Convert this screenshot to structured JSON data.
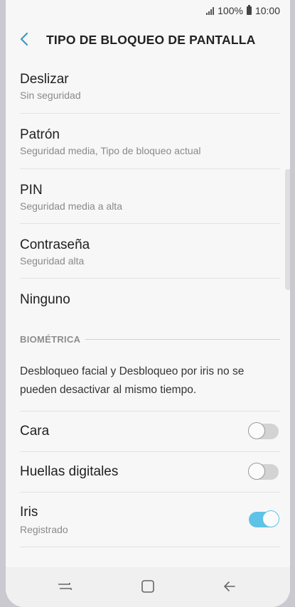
{
  "status_bar": {
    "battery": "100%",
    "time": "10:00"
  },
  "header": {
    "title": "TIPO DE BLOQUEO DE PANTALLA"
  },
  "lock_options": [
    {
      "label": "Deslizar",
      "sub": "Sin seguridad"
    },
    {
      "label": "Patrón",
      "sub": "Seguridad media, Tipo de bloqueo actual"
    },
    {
      "label": "PIN",
      "sub": "Seguridad media a alta"
    },
    {
      "label": "Contraseña",
      "sub": "Seguridad alta"
    },
    {
      "label": "Ninguno"
    }
  ],
  "biometrics": {
    "section_title": "BIOMÉTRICA",
    "info": "Desbloqueo facial y Desbloqueo por iris no se pueden desactivar al mismo tiempo.",
    "items": [
      {
        "label": "Cara",
        "enabled": false
      },
      {
        "label": "Huellas digitales",
        "enabled": false
      },
      {
        "label": "Iris",
        "sub": "Registrado",
        "enabled": true
      }
    ]
  },
  "colors": {
    "accent": "#5ec3e6",
    "background": "#f7f7f7"
  }
}
